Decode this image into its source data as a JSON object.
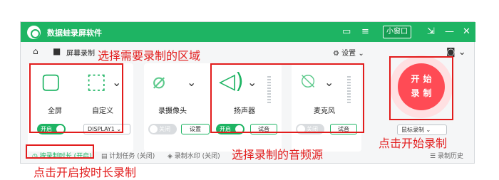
{
  "app": {
    "title": "数据蛙录屏软件",
    "mini_window": "小窗口"
  },
  "toolbar": {
    "breadcrumb": "屏幕录制",
    "settings_label": "设置"
  },
  "panels": {
    "screen": {
      "fullscreen_label": "全屏",
      "custom_label": "自定义",
      "toggle": "开启",
      "display_value": "DISPLAY1"
    },
    "camera": {
      "label": "录摄像头",
      "toggle": "关闭",
      "button": "设置"
    },
    "speaker": {
      "label": "扬声器",
      "toggle": "开启",
      "button": "试音"
    },
    "microphone": {
      "label": "麦克风",
      "toggle": "关闭",
      "button": "试音"
    }
  },
  "record": {
    "line1": "开始",
    "line2": "录制",
    "mode_value": "鼠标录制"
  },
  "status": {
    "timer": "按录制时长 (开启)",
    "schedule": "计划任务 (关闭)",
    "watermark": "录制水印 (关闭)",
    "history": "录制历史"
  },
  "annotations": {
    "select_area": "选择需要录制的区域",
    "select_audio": "选择录制的音频源",
    "click_start": "点击开始录制",
    "click_timer": "点击开启按时长录制"
  },
  "colors": {
    "brand_green": "#1eb463",
    "record_red": "#ff4b55",
    "annotation_red": "#e21c1c"
  },
  "icons": [
    "logo-icon",
    "feedback-icon",
    "menu-icon",
    "pin-icon",
    "close-icon",
    "home-icon",
    "video-icon",
    "settings-icon",
    "camera-icon",
    "monitor-icon",
    "cursor-select-icon",
    "webcam-off-icon",
    "speaker-icon",
    "microphone-off-icon",
    "clock-icon",
    "calendar-icon",
    "water-drop-icon",
    "list-icon"
  ]
}
